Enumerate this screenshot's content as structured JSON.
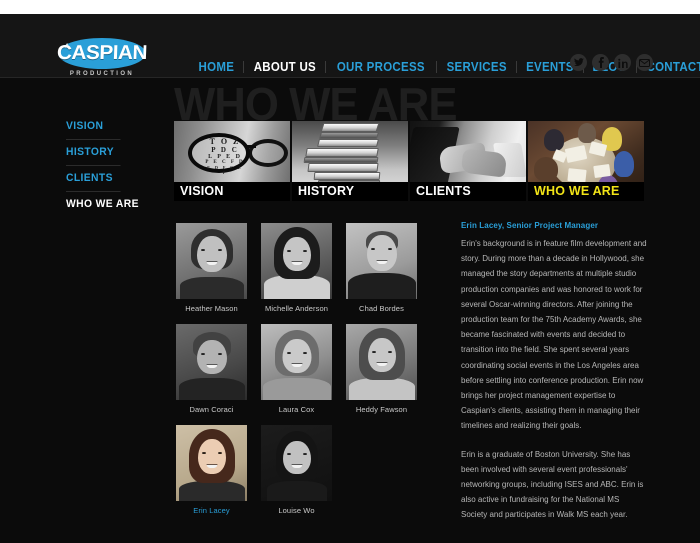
{
  "site": {
    "logo_word": "CASPIAN",
    "logo_a": "A",
    "logo_sub": "PRODUCTION",
    "brand_blue": "#2a9fd8",
    "accent_yellow": "#f2e417",
    "background": "#0b0b0b"
  },
  "nav": {
    "items": [
      {
        "label": "HOME",
        "active": false
      },
      {
        "label": "ABOUT US",
        "active": true
      },
      {
        "label": "OUR PROCESS",
        "active": false
      },
      {
        "label": "SERVICES",
        "active": false
      },
      {
        "label": "EVENTS",
        "active": false
      },
      {
        "label": "BLOG",
        "active": false
      },
      {
        "label": "CONTACT",
        "active": false
      }
    ]
  },
  "social": {
    "icons": [
      {
        "name": "twitter-icon"
      },
      {
        "name": "facebook-icon"
      },
      {
        "name": "linkedin-icon"
      },
      {
        "name": "email-icon"
      }
    ]
  },
  "page": {
    "watermark": "WHO WE ARE"
  },
  "sidebar": {
    "items": [
      {
        "label": "VISION",
        "active": false
      },
      {
        "label": "HISTORY",
        "active": false
      },
      {
        "label": "CLIENTS",
        "active": false
      },
      {
        "label": "WHO WE ARE",
        "active": true
      }
    ]
  },
  "tiles": [
    {
      "label": "VISION",
      "active": false,
      "image": "eyeglasses-eye-chart"
    },
    {
      "label": "HISTORY",
      "active": false,
      "image": "stacked-books"
    },
    {
      "label": "CLIENTS",
      "active": false,
      "image": "handshake"
    },
    {
      "label": "WHO WE ARE",
      "active": true,
      "image": "team-meeting-overhead"
    }
  ],
  "eye_chart": {
    "rows": [
      "T O Z",
      "P D C",
      "L P E D",
      "P E C F D",
      "E D F C Z P"
    ]
  },
  "team": {
    "rows": [
      [
        {
          "name": "Heather Mason",
          "selected": false
        },
        {
          "name": "Michelle Anderson",
          "selected": false
        },
        {
          "name": "Chad Bordes",
          "selected": false
        }
      ],
      [
        {
          "name": "Dawn Coraci",
          "selected": false
        },
        {
          "name": "Laura Cox",
          "selected": false
        },
        {
          "name": "Heddy Fawson",
          "selected": false
        }
      ],
      [
        {
          "name": "Erin Lacey",
          "selected": true
        },
        {
          "name": "Louise Wo",
          "selected": false
        }
      ]
    ]
  },
  "bio": {
    "title": "Erin Lacey, Senior Project Manager",
    "paragraphs": [
      "Erin's background is in feature film development and story. During more than a decade in Hollywood, she managed the story departments at multiple studio production companies and was honored to work for several Oscar-winning directors. After joining the production team for the 75th Academy Awards, she became fascinated with events and decided to transition into the field. She spent several years coordinating social events in the Los Angeles area before settling into conference production. Erin now brings her project management expertise to Caspian's clients, assisting them in managing their timelines and realizing their goals.",
      "Erin is a graduate of Boston University. She has been involved with several event professionals' networking groups, including ISES and ABC. Erin is also active in fundraising for the National MS Society and participates in Walk MS each year."
    ]
  }
}
